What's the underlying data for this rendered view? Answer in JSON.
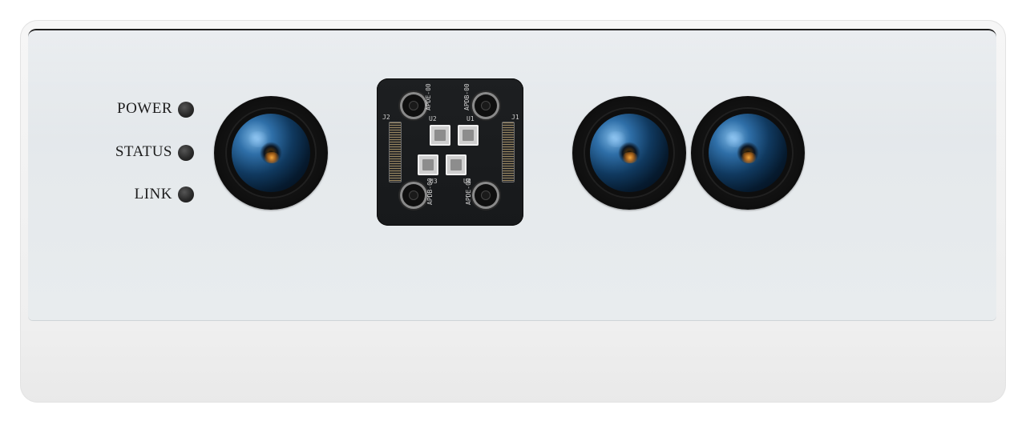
{
  "leds": [
    {
      "label": "POWER"
    },
    {
      "label": "STATUS"
    },
    {
      "label": "LINK"
    }
  ],
  "board": {
    "connectors": [
      "J2",
      "J1"
    ],
    "chips": [
      "U2",
      "U1",
      "U3",
      "U4"
    ],
    "silk": [
      "APDE-00",
      "APDB-00",
      "APDB-00",
      "APDE-00"
    ]
  },
  "colors": {
    "housing": "#efefef",
    "panel": "#e3e8eb",
    "board": "#1b1d1f",
    "led": "#2a2a2a",
    "lens_glass": "#2f6fa8"
  }
}
